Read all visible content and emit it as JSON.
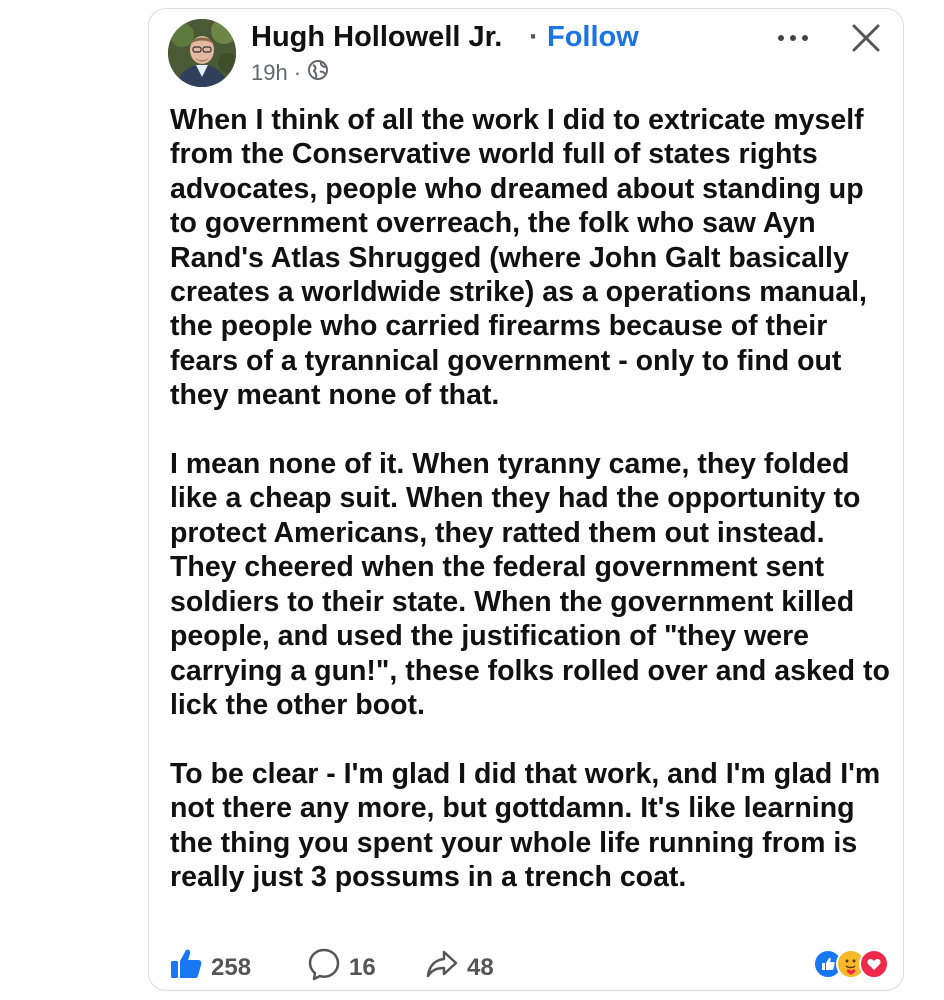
{
  "post": {
    "author": "Hugh Hollowell Jr.",
    "separator": "·",
    "follow_label": "Follow",
    "time": "19h",
    "meta_separator": "·",
    "audience_icon": "globe-icon",
    "text": "When I think of all the work I did to extricate myself from the Conservative world full of states rights advocates, people who dreamed about standing up to government overreach, the folk who saw Ayn Rand's Atlas Shrugged (where John Galt basically creates a worldwide strike) as a operations manual, the people who carried firearms because of their fears of a tyrannical government - only to find out they meant none of that.\n\nI mean none of it. When tyranny came, they folded like a cheap suit. When they had the opportunity to protect Americans, they ratted them out instead. They cheered when the federal government sent soldiers to their state. When the government killed people, and used the justification of \"they were carrying a gun!\", these folks rolled over and asked to lick the other boot.\n\nTo be clear - I'm glad I did that work, and I'm glad I'm not there any more, but gottdamn. It's like learning the thing you spent your whole life running from is really just 3 possums in a trench coat."
  },
  "footer": {
    "likes": "258",
    "comments": "16",
    "shares": "48",
    "reaction_icons": [
      "like-icon",
      "care-icon",
      "love-icon"
    ]
  },
  "colors": {
    "accent": "#1b74e4",
    "like_blue": "#1877f2",
    "love_red": "#f02849",
    "care_yellow": "#f7b928",
    "muted": "#65676b"
  }
}
